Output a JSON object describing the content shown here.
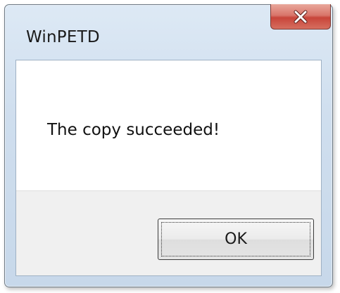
{
  "window": {
    "title": "WinPETD",
    "close_icon": "close-icon"
  },
  "dialog": {
    "message": "The copy succeeded!",
    "ok_label": "OK"
  },
  "colors": {
    "close_button": "#c8453a",
    "frame": "#cfdeee",
    "message_background": "#ffffff",
    "button_area": "#f0f0f0"
  }
}
